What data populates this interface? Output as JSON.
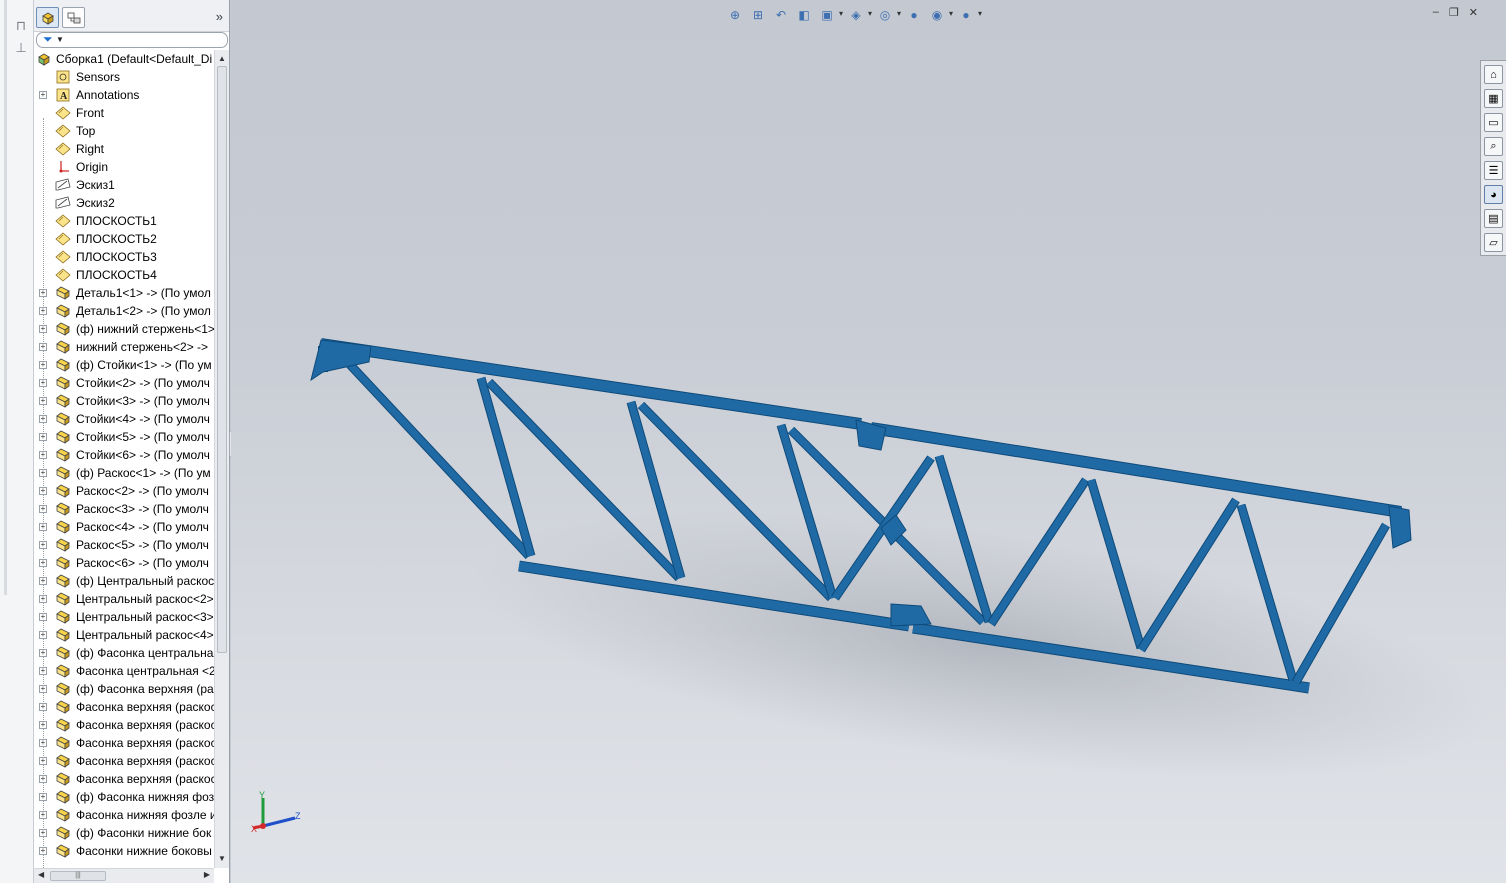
{
  "left_strip": {
    "icons": [
      "smartmate-icon",
      "step-icon"
    ]
  },
  "feature_manager": {
    "tabs": [
      {
        "name": "featuremanager-tab",
        "active": true
      },
      {
        "name": "configuration-manager-tab",
        "active": false
      }
    ],
    "expand_glyph": "»",
    "filter_icon": "filter-icon",
    "tree": [
      {
        "label": "Сборка1  (Default<Default_Di",
        "icon": "assembly-icon",
        "root": true
      },
      {
        "label": "Sensors",
        "icon": "sensor-icon",
        "expandable": false
      },
      {
        "label": "Annotations",
        "icon": "annotation-icon",
        "expandable": true
      },
      {
        "label": "Front",
        "icon": "plane-icon",
        "expandable": false
      },
      {
        "label": "Top",
        "icon": "plane-icon",
        "expandable": false
      },
      {
        "label": "Right",
        "icon": "plane-icon",
        "expandable": false
      },
      {
        "label": "Origin",
        "icon": "origin-icon",
        "expandable": false
      },
      {
        "label": "Эскиз1",
        "icon": "sketch-icon",
        "expandable": false
      },
      {
        "label": "Эскиз2",
        "icon": "sketch-icon",
        "expandable": false
      },
      {
        "label": "ПЛОСКОСТЬ1",
        "icon": "plane-icon",
        "expandable": false
      },
      {
        "label": "ПЛОСКОСТЬ2",
        "icon": "plane-icon",
        "expandable": false
      },
      {
        "label": "ПЛОСКОСТЬ3",
        "icon": "plane-icon",
        "expandable": false
      },
      {
        "label": "ПЛОСКОСТЬ4",
        "icon": "plane-icon",
        "expandable": false
      },
      {
        "label": "Деталь1<1> -> (По умол",
        "icon": "part-icon",
        "expandable": true
      },
      {
        "label": "Деталь1<2> -> (По умол",
        "icon": "part-icon",
        "expandable": true
      },
      {
        "label": "(ф) нижний стержень<1>",
        "icon": "part-icon",
        "expandable": true
      },
      {
        "label": "нижний стержень<2> ->",
        "icon": "part-icon",
        "expandable": true
      },
      {
        "label": "(ф) Стойки<1> -> (По ум",
        "icon": "part-icon",
        "expandable": true
      },
      {
        "label": "Стойки<2> -> (По умолч",
        "icon": "part-icon",
        "expandable": true
      },
      {
        "label": "Стойки<3> -> (По умолч",
        "icon": "part-icon",
        "expandable": true
      },
      {
        "label": "Стойки<4> -> (По умолч",
        "icon": "part-icon",
        "expandable": true
      },
      {
        "label": "Стойки<5> -> (По умолч",
        "icon": "part-icon",
        "expandable": true
      },
      {
        "label": "Стойки<6> -> (По умолч",
        "icon": "part-icon",
        "expandable": true
      },
      {
        "label": "(ф) Раскос<1> -> (По ум",
        "icon": "part-icon",
        "expandable": true
      },
      {
        "label": "Раскос<2> -> (По умолч",
        "icon": "part-icon",
        "expandable": true
      },
      {
        "label": "Раскос<3> -> (По умолч",
        "icon": "part-icon",
        "expandable": true
      },
      {
        "label": "Раскос<4> -> (По умолч",
        "icon": "part-icon",
        "expandable": true
      },
      {
        "label": "Раскос<5> -> (По умолч",
        "icon": "part-icon",
        "expandable": true
      },
      {
        "label": "Раскос<6> -> (По умолч",
        "icon": "part-icon",
        "expandable": true
      },
      {
        "label": "(ф) Центральный раскос",
        "icon": "part-icon",
        "expandable": true
      },
      {
        "label": "Центральный раскос<2>",
        "icon": "part-icon",
        "expandable": true
      },
      {
        "label": "Центральный раскос<3>",
        "icon": "part-icon",
        "expandable": true
      },
      {
        "label": "Центральный раскос<4>",
        "icon": "part-icon",
        "expandable": true
      },
      {
        "label": "(ф) Фасонка центральная",
        "icon": "part-icon",
        "expandable": true
      },
      {
        "label": "Фасонка центральная <2",
        "icon": "part-icon",
        "expandable": true
      },
      {
        "label": "(ф) Фасонка верхняя (рас",
        "icon": "part-icon",
        "expandable": true
      },
      {
        "label": "Фасонка верхняя (раскос",
        "icon": "part-icon",
        "expandable": true
      },
      {
        "label": "Фасонка верхняя (раскос",
        "icon": "part-icon",
        "expandable": true
      },
      {
        "label": "Фасонка верхняя (раскос",
        "icon": "part-icon",
        "expandable": true
      },
      {
        "label": "Фасонка верхняя (раскос",
        "icon": "part-icon",
        "expandable": true
      },
      {
        "label": "Фасонка верхняя (раскос",
        "icon": "part-icon",
        "expandable": true
      },
      {
        "label": "(ф) Фасонка нижняя фоз",
        "icon": "part-icon",
        "expandable": true
      },
      {
        "label": "Фасонка нижняя фозле и",
        "icon": "part-icon",
        "expandable": true
      },
      {
        "label": "(ф) Фасонки нижние бок",
        "icon": "part-icon",
        "expandable": true
      },
      {
        "label": "Фасонки нижние боковы",
        "icon": "part-icon",
        "expandable": true
      }
    ]
  },
  "view_toolbar": {
    "items": [
      {
        "name": "zoom-to-fit-icon",
        "glyph": "⊕",
        "dropdown": false
      },
      {
        "name": "zoom-to-area-icon",
        "glyph": "⊞",
        "dropdown": false
      },
      {
        "name": "previous-view-icon",
        "glyph": "↶",
        "dropdown": false
      },
      {
        "name": "section-view-icon",
        "glyph": "◧",
        "dropdown": false
      },
      {
        "name": "view-orientation-icon",
        "glyph": "▣",
        "dropdown": true
      },
      {
        "name": "display-style-icon",
        "glyph": "◈",
        "dropdown": true
      },
      {
        "name": "hide-show-items-icon",
        "glyph": "◎",
        "dropdown": true
      },
      {
        "name": "edit-appearance-icon",
        "glyph": "●",
        "dropdown": false
      },
      {
        "name": "apply-scene-icon",
        "glyph": "◉",
        "dropdown": true
      },
      {
        "name": "view-settings-icon",
        "glyph": "●",
        "dropdown": true
      }
    ]
  },
  "window_controls": [
    "–",
    "❐",
    "✕"
  ],
  "task_pane": {
    "items": [
      {
        "name": "solidworks-resources-icon",
        "glyph": "⌂"
      },
      {
        "name": "design-library-icon",
        "glyph": "▦"
      },
      {
        "name": "file-explorer-icon",
        "glyph": "▭"
      },
      {
        "name": "search-icon",
        "glyph": "⌕"
      },
      {
        "name": "view-palette-icon",
        "glyph": "☰"
      },
      {
        "name": "appearances-scenes-icon",
        "glyph": "◕"
      },
      {
        "name": "custom-properties-icon",
        "glyph": "▤"
      },
      {
        "name": "solidworks-forum-icon",
        "glyph": "▱"
      }
    ]
  },
  "triad": {
    "x_label": "X",
    "y_label": "Y",
    "z_label": "Z"
  },
  "colors": {
    "model": "#1f6aa5",
    "model_dark": "#0e4a7a",
    "viewport_top": "#c3c8d1",
    "viewport_bottom": "#e0e3e8"
  }
}
